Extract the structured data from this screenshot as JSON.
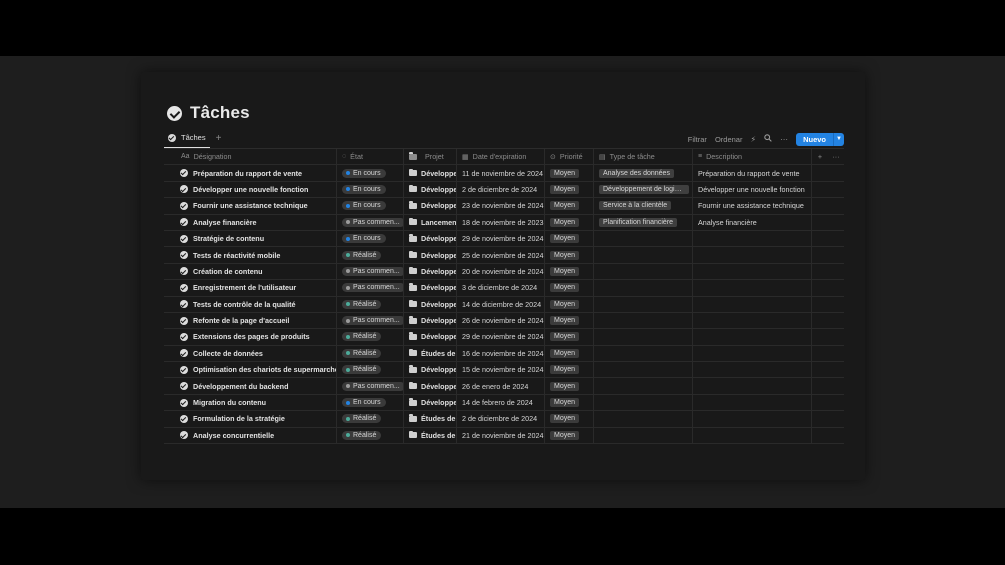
{
  "page": {
    "title": "Tâches",
    "tab_label": "Tâches",
    "add_view": "+"
  },
  "toolbar": {
    "filter": "Filtrar",
    "sort": "Ordenar",
    "new_button": "Nuevo",
    "icons": [
      "lightning-icon",
      "search-icon",
      "more-icon",
      "chevron-down-icon"
    ]
  },
  "colors": {
    "accent": "#2383e2",
    "status_in_progress": "#2383e2",
    "status_done": "#4dab9a",
    "status_not_started": "#9b9b9b"
  },
  "columns": [
    {
      "label": "Désignation",
      "icon": "Aa"
    },
    {
      "label": "État",
      "icon": "status-icon"
    },
    {
      "label": "Projet",
      "icon": "folder-icon"
    },
    {
      "label": "Date d'expiration",
      "icon": "calendar-icon"
    },
    {
      "label": "Priorité",
      "icon": "priority-icon"
    },
    {
      "label": "Type de tâche",
      "icon": "tag-icon"
    },
    {
      "label": "Description",
      "icon": "text-icon"
    },
    {
      "label": "+",
      "icon": "add-column-icon"
    },
    {
      "label": "···",
      "icon": "more-icon"
    }
  ],
  "rows": [
    {
      "name": "Préparation du rapport de vente",
      "status": "En cours",
      "status_kind": "progress",
      "project": "Développer",
      "date": "11 de noviembre de 2024",
      "priority": "Moyen",
      "type": "Analyse des données",
      "description": "Préparation du rapport de vente"
    },
    {
      "name": "Développer une nouvelle fonction",
      "status": "En cours",
      "status_kind": "progress",
      "project": "Développer",
      "date": "2 de diciembre de 2024",
      "priority": "Moyen",
      "type": "Développement de logici...",
      "description": "Développer une nouvelle fonction"
    },
    {
      "name": "Fournir une assistance technique",
      "status": "En cours",
      "status_kind": "progress",
      "project": "Développer",
      "date": "23 de noviembre de 2024",
      "priority": "Moyen",
      "type": "Service à la clientèle",
      "description": "Fournir une assistance technique"
    },
    {
      "name": "Analyse financière",
      "status": "Pas commen...",
      "status_kind": "not_started",
      "project": "Lancement d",
      "date": "18 de noviembre de 2023",
      "priority": "Moyen",
      "type": "Planification financière",
      "description": "Analyse financière"
    },
    {
      "name": "Stratégie de contenu",
      "status": "En cours",
      "status_kind": "progress",
      "project": "Développer",
      "date": "29 de noviembre de 2024",
      "priority": "Moyen",
      "type": "",
      "description": ""
    },
    {
      "name": "Tests de réactivité mobile",
      "status": "Réalisé",
      "status_kind": "done",
      "project": "Développer",
      "date": "25 de noviembre de 2024",
      "priority": "Moyen",
      "type": "",
      "description": ""
    },
    {
      "name": "Création de contenu",
      "status": "Pas commen...",
      "status_kind": "not_started",
      "project": "Développer",
      "date": "20 de noviembre de 2024",
      "priority": "Moyen",
      "type": "",
      "description": ""
    },
    {
      "name": "Enregistrement de l'utilisateur",
      "status": "Pas commen...",
      "status_kind": "not_started",
      "project": "Développer",
      "date": "3 de diciembre de 2024",
      "priority": "Moyen",
      "type": "",
      "description": ""
    },
    {
      "name": "Tests de contrôle de la qualité",
      "status": "Réalisé",
      "status_kind": "done",
      "project": "Développer",
      "date": "14 de diciembre de 2024",
      "priority": "Moyen",
      "type": "",
      "description": ""
    },
    {
      "name": "Refonte de la page d'accueil",
      "status": "Pas commen...",
      "status_kind": "not_started",
      "project": "Développer",
      "date": "26 de noviembre de 2024",
      "priority": "Moyen",
      "type": "",
      "description": ""
    },
    {
      "name": "Extensions des pages de produits",
      "status": "Réalisé",
      "status_kind": "done",
      "project": "Développer",
      "date": "29 de noviembre de 2024",
      "priority": "Moyen",
      "type": "",
      "description": ""
    },
    {
      "name": "Collecte de données",
      "status": "Réalisé",
      "status_kind": "done",
      "project": "Études de m",
      "date": "16 de noviembre de 2024",
      "priority": "Moyen",
      "type": "",
      "description": ""
    },
    {
      "name": "Optimisation des chariots de supermarché",
      "status": "Réalisé",
      "status_kind": "done",
      "project": "Développer",
      "date": "15 de noviembre de 2024",
      "priority": "Moyen",
      "type": "",
      "description": ""
    },
    {
      "name": "Développement du backend",
      "status": "Pas commen...",
      "status_kind": "not_started",
      "project": "Développer",
      "date": "26 de enero de 2024",
      "priority": "Moyen",
      "type": "",
      "description": ""
    },
    {
      "name": "Migration du contenu",
      "status": "En cours",
      "status_kind": "progress",
      "project": "Développer",
      "date": "14 de febrero de 2024",
      "priority": "Moyen",
      "type": "",
      "description": ""
    },
    {
      "name": "Formulation de la stratégie",
      "status": "Réalisé",
      "status_kind": "done",
      "project": "Études de m",
      "date": "2 de diciembre de 2024",
      "priority": "Moyen",
      "type": "",
      "description": ""
    },
    {
      "name": "Analyse concurrentielle",
      "status": "Réalisé",
      "status_kind": "done",
      "project": "Études de m",
      "date": "21 de noviembre de 2024",
      "priority": "Moyen",
      "type": "",
      "description": ""
    }
  ]
}
